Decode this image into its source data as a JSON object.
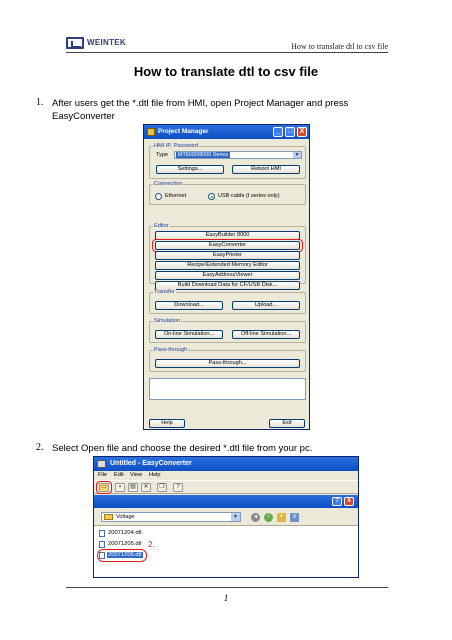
{
  "header": {
    "logo_text": "WEINTEK",
    "right_text": "How to translate dtl to csv file"
  },
  "title": "How to translate dtl to csv file",
  "steps": [
    {
      "num": "1.",
      "text": "After users get the *.dtl file from HMI, open Project Manager and press EasyConverter"
    },
    {
      "num": "2.",
      "text": "Select Open file and choose the desired *.dtl file from your pc."
    }
  ],
  "page_number": "1",
  "project_manager": {
    "title": "Project Manager",
    "window_buttons": [
      "_",
      "□",
      "X"
    ],
    "hmi_group": {
      "label": "HMI IP, Password",
      "type_label": "Type",
      "type_value": "MT6000/8000 Series",
      "settings_btn": "Settings...",
      "reboot_btn": "Reboot HMI"
    },
    "connection": {
      "label": "Connection",
      "options": [
        "Ethernet",
        "USB cable (I series only)"
      ],
      "selected_index": 1
    },
    "editor": {
      "label": "Editor",
      "buttons": [
        "EasyBuilder 8000",
        "EasyConverter",
        "EasyPrinter",
        "Recipe/Extended Memory Editor",
        "EasyAddressViewer",
        "Build Download Data for CF/USB Disk..."
      ],
      "highlighted_index": 1
    },
    "transfer": {
      "label": "Transfer",
      "buttons": [
        "Download...",
        "Upload..."
      ]
    },
    "simulation": {
      "label": "Simulation",
      "buttons": [
        "On-line Simulation...",
        "Off-line Simulation..."
      ]
    },
    "pass_through": {
      "label": "Pass-through",
      "button": "Pass-through..."
    },
    "help_btn": "Help",
    "exit_btn": "Exit"
  },
  "easy_converter": {
    "title": "Untitled - EasyConverter",
    "menu": [
      "File",
      "Edit",
      "View",
      "Help"
    ],
    "toolbar_icons": [
      "open-folder-icon",
      "save-icon",
      "print-icon",
      "export-icon",
      "copy-icon",
      "help-icon"
    ],
    "dialog_buttons": [
      "?",
      "X"
    ],
    "look_in": "Voltage",
    "files": [
      "20071204.dtl",
      "20071205.dtl",
      "20071206.dtl"
    ],
    "selected_file_index": 2,
    "annotation": "2."
  }
}
